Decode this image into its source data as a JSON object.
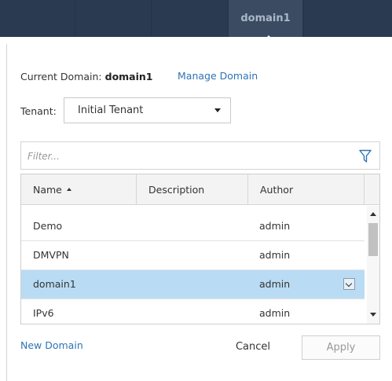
{
  "header": {
    "active_domain_tab": "domain1"
  },
  "domain_panel": {
    "current_domain_label": "Current Domain:",
    "current_domain_value": "domain1",
    "manage_link": "Manage Domain",
    "tenant_label": "Tenant:",
    "tenant_value": "Initial Tenant",
    "filter_placeholder": "Filter...",
    "columns": [
      "Name",
      "Description",
      "Author"
    ],
    "rows": [
      {
        "name": "Demo",
        "description": "",
        "author": "admin",
        "selected": false
      },
      {
        "name": "DMVPN",
        "description": "",
        "author": "admin",
        "selected": false
      },
      {
        "name": "domain1",
        "description": "",
        "author": "admin",
        "selected": true
      },
      {
        "name": "IPv6",
        "description": "",
        "author": "admin",
        "selected": false
      }
    ],
    "new_domain_link": "New Domain",
    "cancel_label": "Cancel",
    "apply_label": "Apply",
    "colors": {
      "topbar": "#2a3b51",
      "link": "#2e74b5",
      "selected_row": "#b9dcf4"
    }
  }
}
